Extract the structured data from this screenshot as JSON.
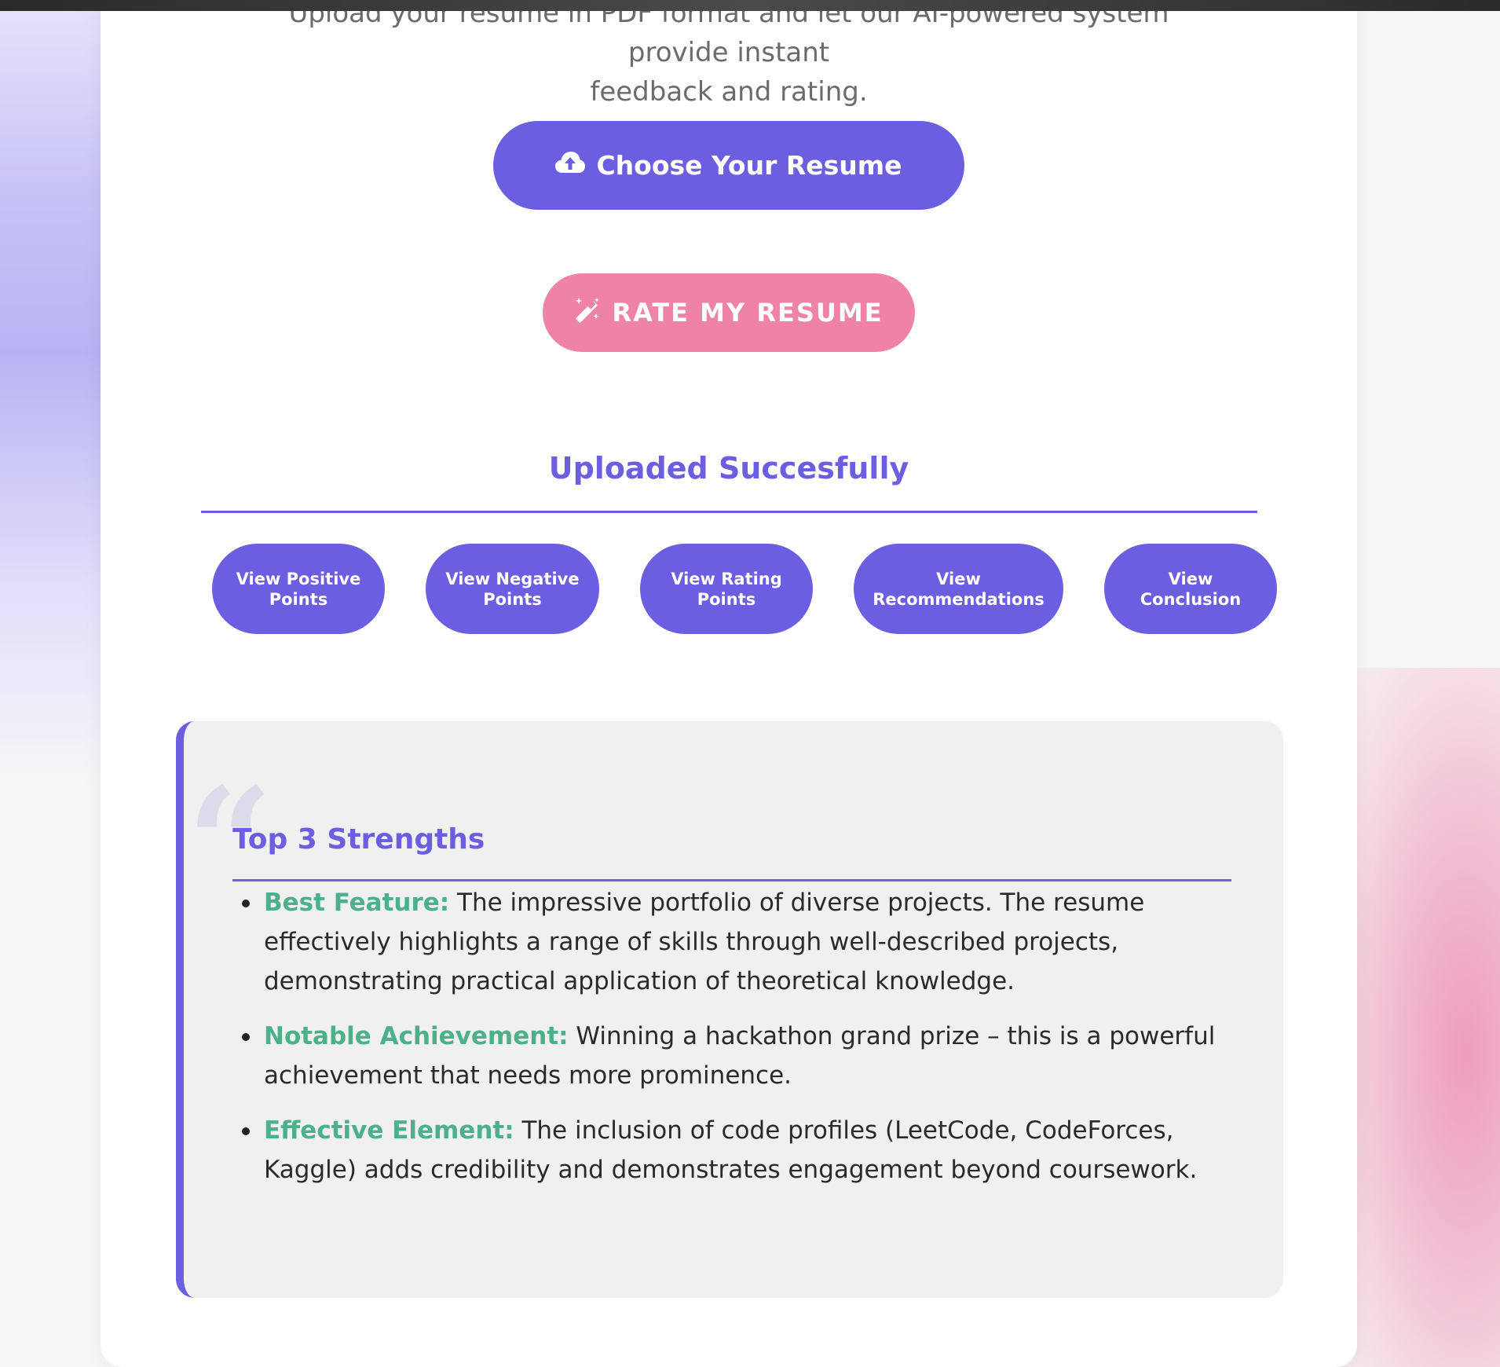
{
  "intro": {
    "line1": "Upload your resume in PDF format and let our AI-powered system provide instant",
    "line2": "feedback and rating."
  },
  "buttons": {
    "choose_label": "Choose Your Resume",
    "rate_label": "RATE MY RESUME"
  },
  "icons": {
    "choose": "cloud-upload-icon",
    "rate": "magic-wand-icon"
  },
  "status": {
    "title": "Uploaded Succesfully"
  },
  "view_buttons": [
    {
      "line1": "View Positive",
      "line2": "Points"
    },
    {
      "line1": "View Negative",
      "line2": "Points"
    },
    {
      "line1": "View Rating",
      "line2": "Points"
    },
    {
      "line1": "View",
      "line2": "Recommendations"
    },
    {
      "line1": "View",
      "line2": "Conclusion"
    }
  ],
  "panel": {
    "title": "Top 3 Strengths",
    "quote_glyph": "“",
    "items": [
      {
        "label": "Best Feature:",
        "text": " The impressive portfolio of diverse projects. The resume effectively highlights a range of skills through well-described projects, demonstrating practical application of theoretical knowledge."
      },
      {
        "label": "Notable Achievement:",
        "text": " Winning a hackathon grand prize – this is a powerful achievement that needs more prominence."
      },
      {
        "label": "Effective Element:",
        "text": " The inclusion of code profiles (LeetCode, CodeForces, Kaggle) adds credibility and demonstrates engagement beyond coursework."
      }
    ]
  },
  "colors": {
    "primary": "#6b5ee0",
    "pink": "#ee82a7",
    "green": "#4cb08a",
    "panel_bg": "#f0f0f0"
  }
}
